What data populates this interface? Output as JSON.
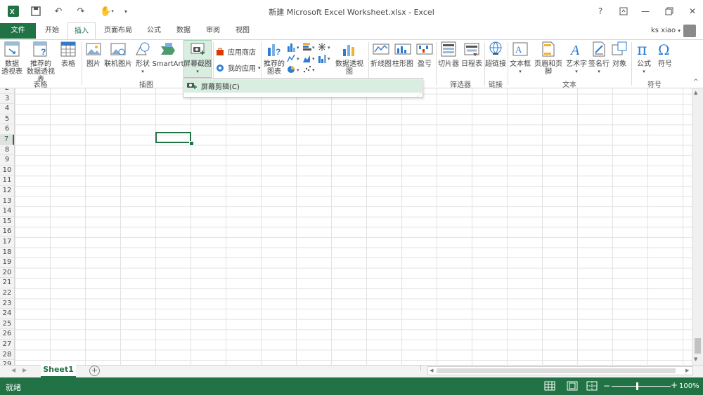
{
  "window": {
    "title": "新建 Microsoft Excel Worksheet.xlsx - Excel"
  },
  "tabs": [
    {
      "label": "文件"
    },
    {
      "label": "开始"
    },
    {
      "label": "插入"
    },
    {
      "label": "页面布局"
    },
    {
      "label": "公式"
    },
    {
      "label": "数据"
    },
    {
      "label": "审阅"
    },
    {
      "label": "视图"
    }
  ],
  "user": {
    "name": "ks xiao"
  },
  "ribbon": {
    "pivot_table": "数据\n透视表",
    "recommended_pivot": "推荐的\n数据透视表",
    "table": "表格",
    "group_tables": "表格",
    "picture": "图片",
    "online_picture": "联机图片",
    "shapes": "形状",
    "smartart": "SmartArt",
    "screenshot": "屏幕截图",
    "group_illustrations": "插图",
    "store": "应用商店",
    "my_apps": "我的应用",
    "recommended_charts": "推荐的\n图表",
    "pivot_chart": "数据透视图",
    "spark_line": "折线图",
    "spark_column": "柱形图",
    "spark_winloss": "盈亏",
    "slicer": "切片器",
    "timeline": "日程表",
    "group_filters": "筛选器",
    "hyperlink": "超链接",
    "group_links": "链接",
    "textbox": "文本框",
    "header_footer": "页眉和页脚",
    "wordart": "艺术字",
    "signature": "签名行",
    "object": "对象",
    "group_text": "文本",
    "equation": "公式",
    "symbol": "符号",
    "group_symbols": "符号"
  },
  "dropdown": {
    "item": "屏幕剪辑(C)"
  },
  "grid": {
    "rows": [
      "2",
      "3",
      "4",
      "5",
      "6",
      "7",
      "8",
      "9",
      "10",
      "11",
      "12",
      "13",
      "14",
      "15",
      "16",
      "17",
      "18",
      "19",
      "20",
      "21",
      "22",
      "23",
      "24",
      "25",
      "26",
      "27",
      "28",
      "29"
    ],
    "selected_row": "7"
  },
  "sheets": [
    {
      "name": "Sheet1"
    }
  ],
  "status": {
    "ready": "就绪",
    "zoom": "100%"
  },
  "colors": {
    "accent": "#217346",
    "highlight": "#d9ede1"
  }
}
